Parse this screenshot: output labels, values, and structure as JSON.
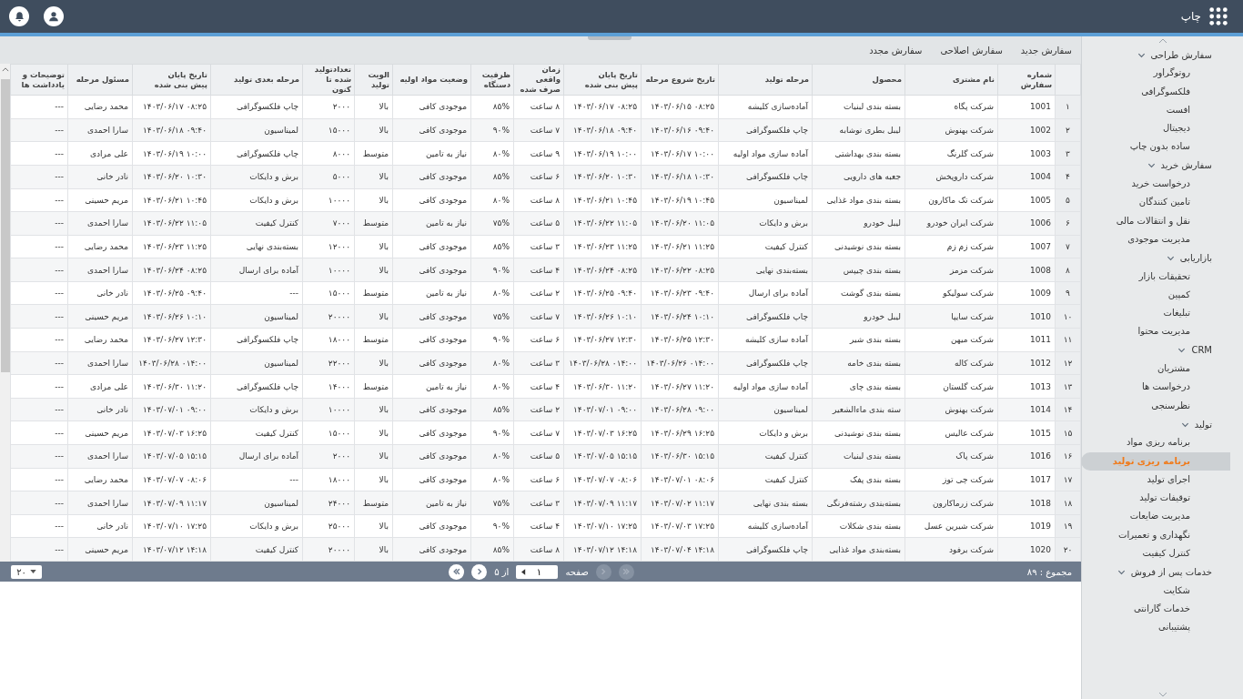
{
  "header": {
    "title": "چاپ"
  },
  "sidebar": {
    "groups": [
      {
        "label": "سفارش طراحی",
        "expanded": true,
        "children": [
          {
            "label": "روتوگراور",
            "selected": false
          },
          {
            "label": "فلکسوگرافی",
            "selected": false
          },
          {
            "label": "افست",
            "selected": false
          },
          {
            "label": "دیجیتال",
            "selected": false
          },
          {
            "label": "ساده بدون چاپ",
            "selected": false
          }
        ]
      },
      {
        "label": "سفارش خرید",
        "expanded": true,
        "children": [
          {
            "label": "درخواست خرید",
            "selected": false
          },
          {
            "label": "تامین کنندگان",
            "selected": false
          },
          {
            "label": "نقل و انتقالات مالی",
            "selected": false
          },
          {
            "label": "مدیریت موجودی",
            "selected": false
          }
        ]
      },
      {
        "label": "بازاریابی",
        "expanded": true,
        "children": [
          {
            "label": "تحقیقات بازار",
            "selected": false
          },
          {
            "label": "کمپین",
            "selected": false
          },
          {
            "label": "تبلیغات",
            "selected": false
          },
          {
            "label": "مدیریت محتوا",
            "selected": false
          }
        ]
      },
      {
        "label": "CRM",
        "expanded": true,
        "children": [
          {
            "label": "مشتریان",
            "selected": false
          },
          {
            "label": "درخواست ها",
            "selected": false
          },
          {
            "label": "نظرسنجی",
            "selected": false
          }
        ]
      },
      {
        "label": "تولید",
        "expanded": true,
        "children": [
          {
            "label": "برنامه ریزی مواد",
            "selected": false
          },
          {
            "label": "برنامه ریزی تولید",
            "selected": true
          },
          {
            "label": "اجرای تولید",
            "selected": false
          },
          {
            "label": "توقیفات تولید",
            "selected": false
          },
          {
            "label": "مدیریت ضایعات",
            "selected": false
          },
          {
            "label": "نگهداری و تعمیرات",
            "selected": false
          },
          {
            "label": "کنترل کیفیت",
            "selected": false
          }
        ]
      },
      {
        "label": "خدمات پس از فروش",
        "expanded": true,
        "children": [
          {
            "label": "شکایت",
            "selected": false
          },
          {
            "label": "خدمات گارانتی",
            "selected": false
          },
          {
            "label": "پشتیبانی",
            "selected": false
          }
        ]
      }
    ]
  },
  "toolbar": [
    "سفارش جدید",
    "سفارش اصلاحی",
    "سفارش مجدد"
  ],
  "table": {
    "columns": [
      "",
      "شماره سفارش",
      "نام مشتری",
      "محصول",
      "مرحله تولید",
      "تاریخ شروع مرحله",
      "تاریخ پایان\nپیش بنی شده",
      "زمان واقعی\nصرف شده",
      "ظرفیت\nدستگاه",
      "وضعیت مواد اولیه",
      "الویت\nتولید",
      "تعدادتولید\nشده تا کنون",
      "مرحله بعدی تولید",
      "تاریخ پایان\nپیش بنی شده",
      "مسئول مرحله",
      "توضیحات و\nیادداشت ها"
    ],
    "rows": [
      [
        "۱",
        "1001",
        "شرکت پگاه",
        "بسته بندی لبنیات",
        "آماده‌سازی کلیشه",
        "۰۸:۲۵ ۱۴۰۳/۰۶/۱۵",
        "۰۸:۲۵ ۱۴۰۳/۰۶/۱۷",
        "۸ ساعت",
        "۸۵%",
        "موجودی کافی",
        "بالا",
        "۲۰۰۰",
        "چاپ فلکسوگرافی",
        "۰۸:۲۵ ۱۴۰۳/۰۶/۱۷",
        "محمد رضایی",
        "---"
      ],
      [
        "۲",
        "1002",
        "شرکت بهنوش",
        "لیبل بطری نوشابه",
        "چاپ فلکسوگرافی",
        "۰۹:۴۰ ۱۴۰۳/۰۶/۱۶",
        "۰۹:۴۰ ۱۴۰۳/۰۶/۱۸",
        "۷ ساعت",
        "۹۰%",
        "موجودی کافی",
        "بالا",
        "۱۵۰۰۰",
        "لمیناسیون",
        "۰۹:۴۰ ۱۴۰۳/۰۶/۱۸",
        "سارا احمدی",
        "---"
      ],
      [
        "۳",
        "1003",
        "شرکت گلرنگ",
        "بسته بندی بهداشتی",
        "آماده سازی مواد اولیه",
        "۱۰:۰۰ ۱۴۰۳/۰۶/۱۷",
        "۱۰:۰۰ ۱۴۰۳/۰۶/۱۹",
        "۹ ساعت",
        "۸۰%",
        "نیاز به تامین",
        "متوسط",
        "۸۰۰۰",
        "چاپ فلکسوگرافی",
        "۱۰:۰۰ ۱۴۰۳/۰۶/۱۹",
        "علی مرادی",
        "---"
      ],
      [
        "۴",
        "1004",
        "شرکت داروپخش",
        "جعبه های دارویی",
        "چاپ فلکسوگرافی",
        "۱۰:۳۰ ۱۴۰۳/۰۶/۱۸",
        "۱۰:۳۰ ۱۴۰۳/۰۶/۲۰",
        "۶ ساعت",
        "۸۵%",
        "موجودی کافی",
        "بالا",
        "۵۰۰۰",
        "برش و دایکات",
        "۱۰:۳۰ ۱۴۰۳/۰۶/۲۰",
        "نادر خانی",
        "---"
      ],
      [
        "۵",
        "1005",
        "شرکت تک ماکارون",
        "بسته بندی مواد غذایی",
        "لمیناسیون",
        "۱۰:۴۵ ۱۴۰۳/۰۶/۱۹",
        "۱۰:۴۵ ۱۴۰۳/۰۶/۲۱",
        "۸ ساعت",
        "۸۰%",
        "موجودی کافی",
        "بالا",
        "۱۰۰۰۰",
        "برش و دایکات",
        "۱۰:۴۵ ۱۴۰۳/۰۶/۲۱",
        "مریم حسینی",
        "---"
      ],
      [
        "۶",
        "1006",
        "شرکت ایران خودرو",
        "لیبل خودرو",
        "برش و دایکات",
        "۱۱:۰۵ ۱۴۰۳/۰۶/۲۰",
        "۱۱:۰۵ ۱۴۰۳/۰۶/۲۲",
        "۵ ساعت",
        "۷۵%",
        "نیاز به تامین",
        "متوسط",
        "۷۰۰۰",
        "کنترل کیفیت",
        "۱۱:۰۵ ۱۴۰۳/۰۶/۲۲",
        "سارا احمدی",
        "---"
      ],
      [
        "۷",
        "1007",
        "شرکت زم زم",
        "بسته بندی نوشیدنی",
        "کنترل کیفیت",
        "۱۱:۲۵ ۱۴۰۳/۰۶/۲۱",
        "۱۱:۲۵ ۱۴۰۳/۰۶/۲۳",
        "۳ ساعت",
        "۸۵%",
        "موجودی کافی",
        "بالا",
        "۱۲۰۰۰",
        "بسته‌بندی نهایی",
        "۱۱:۲۵ ۱۴۰۳/۰۶/۲۳",
        "محمد رضایی",
        "---"
      ],
      [
        "۸",
        "1008",
        "شرکت مزمز",
        "بسته بندی چیپس",
        "بسته‌بندی نهایی",
        "۰۸:۲۵ ۱۴۰۳/۰۶/۲۲",
        "۰۸:۲۵ ۱۴۰۳/۰۶/۲۴",
        "۴ ساعت",
        "۹۰%",
        "موجودی کافی",
        "بالا",
        "۱۰۰۰۰",
        "آماده برای ارسال",
        "۰۸:۲۵ ۱۴۰۳/۰۶/۲۴",
        "سارا احمدی",
        "---"
      ],
      [
        "۹",
        "1009",
        "شرکت سولیکو",
        "بسته بندی گوشت",
        "آماده برای ارسال",
        "۰۹:۴۰ ۱۴۰۳/۰۶/۲۳",
        "۰۹:۴۰ ۱۴۰۳/۰۶/۲۵",
        "۲ ساعت",
        "۸۰%",
        "نیاز به تامین",
        "متوسط",
        "۱۵۰۰۰",
        "---",
        "۰۹:۴۰ ۱۴۰۳/۰۶/۲۵",
        "نادر خانی",
        "---"
      ],
      [
        "۱۰",
        "1010",
        "شرکت سایپا",
        "لیبل خودرو",
        "چاپ فلکسوگرافی",
        "۱۰:۱۰ ۱۴۰۳/۰۶/۲۴",
        "۱۰:۱۰ ۱۴۰۳/۰۶/۲۶",
        "۷ ساعت",
        "۷۵%",
        "موجودی کافی",
        "بالا",
        "۲۰۰۰۰",
        "لمیناسیون",
        "۱۰:۱۰ ۱۴۰۳/۰۶/۲۶",
        "مریم حسینی",
        "---"
      ],
      [
        "۱۱",
        "1011",
        "شرکت میهن",
        "بسته بندی شیر",
        "آماده سازی کلیشه",
        "۱۲:۳۰ ۱۴۰۳/۰۶/۲۵",
        "۱۲:۳۰ ۱۴۰۳/۰۶/۲۷",
        "۶ ساعت",
        "۹۰%",
        "موجودی کافی",
        "متوسط",
        "۱۸۰۰۰",
        "چاپ فلکسوگرافی",
        "۱۲:۳۰ ۱۴۰۳/۰۶/۲۷",
        "محمد رضایی",
        "---"
      ],
      [
        "۱۲",
        "1012",
        "شرکت کاله",
        "بسته بندی خامه",
        "چاپ فلکسوگرافی",
        "۰۱۴:۰۰ ۱۴۰۳/۰۶/۲۶",
        "۰۱۴:۰۰ ۱۴۰۳/۰۶/۲۸",
        "۳ ساعت",
        "۸۰%",
        "موجودی کافی",
        "بالا",
        "۲۲۰۰۰",
        "لمیناسیون",
        "۰۱۴:۰۰ ۱۴۰۳/۰۶/۲۸",
        "سارا احمدی",
        "---"
      ],
      [
        "۱۳",
        "1013",
        "شرکت گلستان",
        "بسته بندی چای",
        "آماده سازی مواد اولیه",
        "۱۱:۲۰ ۱۴۰۳/۰۶/۲۷",
        "۱۱:۲۰ ۱۴۰۳/۰۶/۳۰",
        "۴ ساعت",
        "۸۰%",
        "نیاز به تامین",
        "متوسط",
        "۱۴۰۰۰",
        "چاپ فلکسوگرافی",
        "۱۱:۲۰ ۱۴۰۳/۰۶/۳۰",
        "علی مرادی",
        "---"
      ],
      [
        "۱۴",
        "1014",
        "شرکت بهنوش",
        "سته بندی ماءالشعیر",
        "لمیناسیون",
        "۰۹:۰۰ ۱۴۰۳/۰۶/۲۸",
        "۰۹:۰۰ ۱۴۰۳/۰۷/۰۱",
        "۲ ساعت",
        "۸۵%",
        "موجودی کافی",
        "بالا",
        "۱۰۰۰۰",
        "برش و دایکات",
        "۰۹:۰۰ ۱۴۰۳/۰۷/۰۱",
        "نادر خانی",
        "---"
      ],
      [
        "۱۵",
        "1015",
        "شرکت عالیس",
        "بسته بندی نوشیدنی",
        "برش و دایکات",
        "۱۶:۲۵ ۱۴۰۳/۰۶/۲۹",
        "۱۶:۲۵ ۱۴۰۳/۰۷/۰۳",
        "۷ ساعت",
        "۹۰%",
        "موجودی کافی",
        "بالا",
        "۱۵۰۰۰",
        "کنترل کیفیت",
        "۱۶:۲۵ ۱۴۰۳/۰۷/۰۳",
        "مریم حسینی",
        "---"
      ],
      [
        "۱۶",
        "1016",
        "شرکت پاک",
        "بسته بندی لبنیات",
        "کنترل کیفیت",
        "۱۵:۱۵ ۱۴۰۳/۰۶/۳۰",
        "۱۵:۱۵ ۱۴۰۳/۰۷/۰۵",
        "۵ ساعت",
        "۸۰%",
        "موجودی کافی",
        "بالا",
        "۲۰۰۰",
        "آماده برای ارسال",
        "۱۵:۱۵ ۱۴۰۳/۰۷/۰۵",
        "سارا احمدی",
        "---"
      ],
      [
        "۱۷",
        "1017",
        "شرکت چی توز",
        "بسته بندی پفک",
        "کنترل کیفیت",
        "۰۸:۰۶ ۱۴۰۳/۰۷/۰۱",
        "۰۸:۰۶ ۱۴۰۳/۰۷/۰۷",
        "۶ ساعت",
        "۸۰%",
        "موجودی کافی",
        "بالا",
        "۱۸۰۰۰",
        "---",
        "۰۸:۰۶ ۱۴۰۳/۰۷/۰۷",
        "محمد رضایی",
        "---"
      ],
      [
        "۱۸",
        "1018",
        "شرکت زرماکارون",
        "بسته‌بندی رشته‌فرنگی",
        "بسته بندی نهایی",
        "۱۱:۱۷ ۱۴۰۳/۰۷/۰۲",
        "۱۱:۱۷ ۱۴۰۳/۰۷/۰۹",
        "۳ ساعت",
        "۷۵%",
        "نیاز به تامین",
        "متوسط",
        "۲۴۰۰۰",
        "لمیناسیون",
        "۱۱:۱۷ ۱۴۰۳/۰۷/۰۹",
        "سارا احمدی",
        "---"
      ],
      [
        "۱۹",
        "1019",
        "شرکت شیرین عسل",
        "بسته بندی شکلات",
        "آماده‌سازی کلیشه",
        "۱۷:۲۵ ۱۴۰۳/۰۷/۰۳",
        "۱۷:۲۵ ۱۴۰۳/۰۷/۱۰",
        "۴ ساعت",
        "۹۰%",
        "موجودی کافی",
        "بالا",
        "۲۵۰۰۰",
        "برش و دایکات",
        "۱۷:۲۵ ۱۴۰۳/۰۷/۱۰",
        "نادر خانی",
        "---"
      ],
      [
        "۲۰",
        "1020",
        "شرکت برفود",
        "بسته‌بندی مواد غذایی",
        "چاپ فلکسوگرافی",
        "۱۴:۱۸ ۱۴۰۳/۰۷/۰۴",
        "۱۴:۱۸ ۱۴۰۳/۰۷/۱۲",
        "۸ ساعت",
        "۸۵%",
        "موجودی کافی",
        "بالا",
        "۲۰۰۰۰",
        "کنترل کیفیت",
        "۱۴:۱۸ ۱۴۰۳/۰۷/۱۲",
        "مریم حسینی",
        "---"
      ]
    ]
  },
  "pager": {
    "total": "مجموع : ۸۹",
    "page_label": "صفحه",
    "page": "۱",
    "of_label": "از ۵",
    "page_size": "۲۰",
    "buttons": [
      {
        "kind": "first",
        "disabled": true
      },
      {
        "kind": "prev",
        "disabled": true
      },
      {
        "kind": "next",
        "disabled": false
      },
      {
        "kind": "last",
        "disabled": false
      }
    ]
  }
}
